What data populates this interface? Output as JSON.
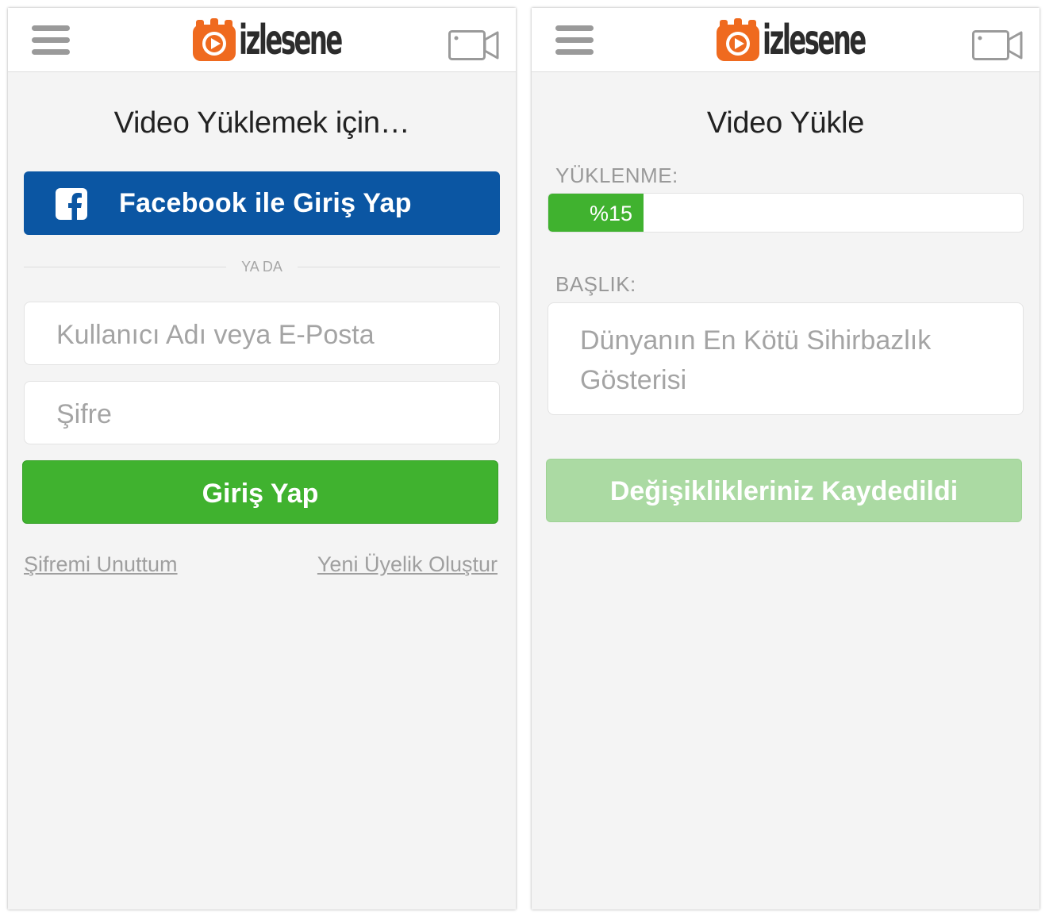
{
  "brand": {
    "name": "izlesene",
    "accent": "#ef6a1f",
    "green": "#40b22f",
    "facebook_blue": "#0b56a3"
  },
  "header": {
    "menu_icon": "hamburger-menu-icon",
    "camera_icon": "video-camera-icon"
  },
  "login_screen": {
    "title": "Video Yüklemek için…",
    "facebook_button": "Facebook ile Giriş Yap",
    "facebook_icon": "facebook-icon",
    "divider_text": "YA DA",
    "username_placeholder": "Kullanıcı Adı veya E-Posta",
    "password_placeholder": "Şifre",
    "login_button": "Giriş Yap",
    "forgot_link": "Şifremi Unuttum",
    "register_link": "Yeni Üyelik Oluştur"
  },
  "upload_screen": {
    "title": "Video Yükle",
    "progress_label": "YÜKLENME:",
    "progress_value": 0.2,
    "progress_text": "%15",
    "title_label": "BAŞLIK:",
    "title_value": "Dünyanın En Kötü Sihirbazlık Gösterisi",
    "save_button": "Değişiklikleriniz Kaydedildi"
  }
}
